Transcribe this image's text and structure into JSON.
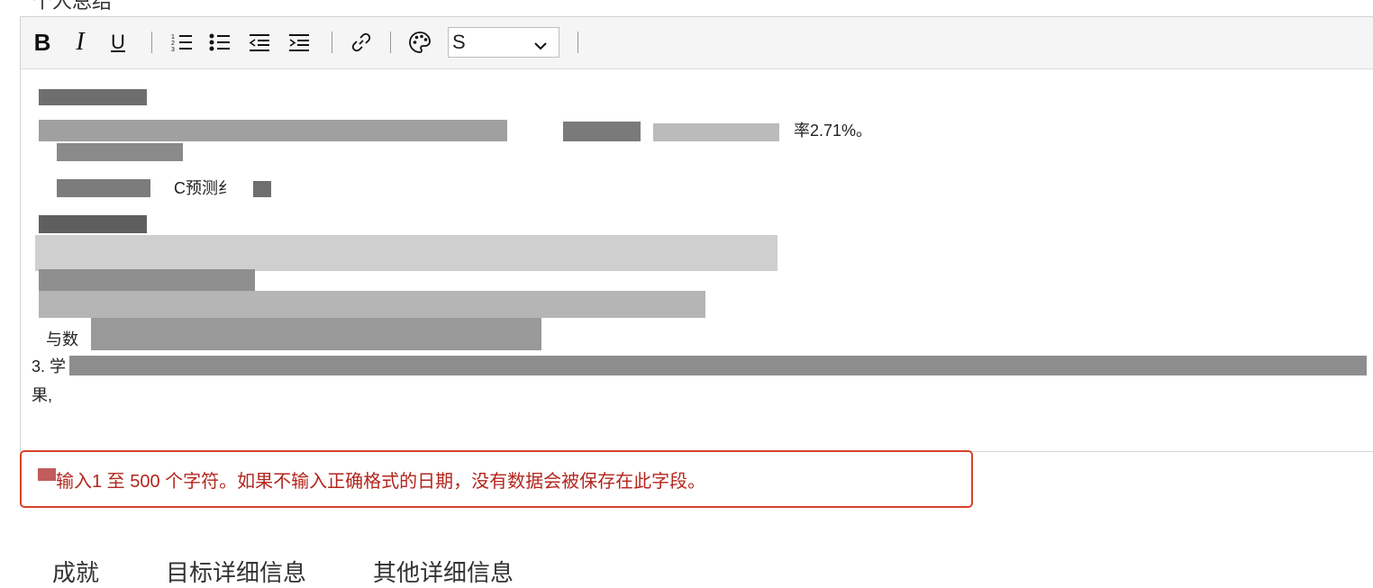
{
  "field": {
    "label": "个人总结"
  },
  "toolbar": {
    "bold": "B",
    "italic": "I",
    "underline": "U",
    "format_select_value": "S"
  },
  "editor": {
    "fragments": {
      "rate_tail": "率2.71%。",
      "fc_line": "C预测纟",
      "number_3": "3. 学",
      "with_data": "与数",
      "guo": "果,"
    }
  },
  "validation": {
    "message": "输入1 至 500 个字符。如果不输入正确格式的日期，没有数据会被保存在此字段。"
  },
  "tabs": [
    {
      "label": "成就"
    },
    {
      "label": "目标详细信息"
    },
    {
      "label": "其他详细信息"
    }
  ]
}
